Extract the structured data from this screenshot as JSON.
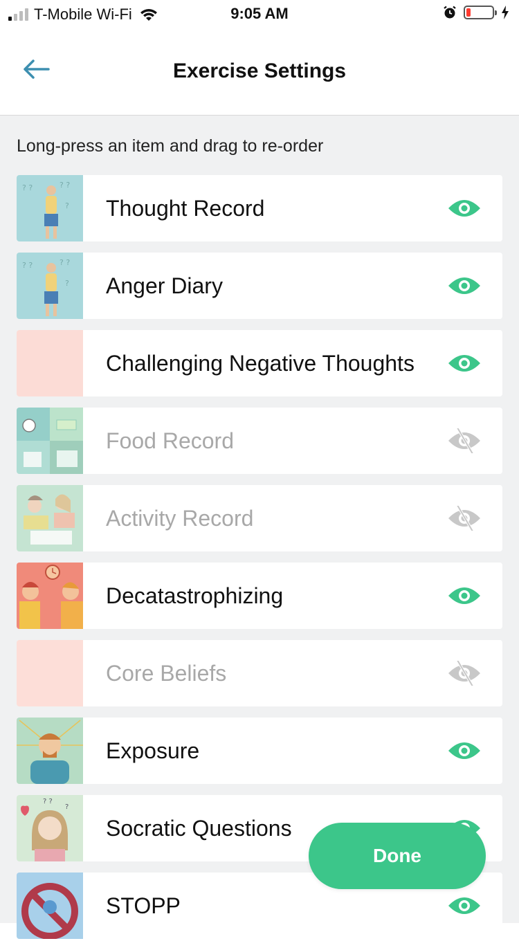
{
  "status_bar": {
    "carrier": "T-Mobile Wi-Fi",
    "time": "9:05 AM",
    "signal_bars": 4,
    "signal_active": 1
  },
  "header": {
    "title": "Exercise Settings",
    "back_icon": "arrow-left-icon"
  },
  "hint": "Long-press an item and drag to re-order",
  "colors": {
    "accent": "#3cc68a",
    "eye_visible": "#3cc68a",
    "eye_hidden": "#c8c8c8",
    "back_arrow": "#3d8fb0"
  },
  "exercises": [
    {
      "label": "Thought Record",
      "visible": true,
      "thumb": "confused-person"
    },
    {
      "label": "Anger Diary",
      "visible": true,
      "thumb": "confused-person"
    },
    {
      "label": "Challenging Negative Thoughts",
      "visible": true,
      "thumb": "blank-pink"
    },
    {
      "label": "Food Record",
      "visible": false,
      "thumb": "food-grid"
    },
    {
      "label": "Activity Record",
      "visible": false,
      "thumb": "people-desk"
    },
    {
      "label": "Decatastrophizing",
      "visible": true,
      "thumb": "arguing-people"
    },
    {
      "label": "Core Beliefs",
      "visible": false,
      "thumb": "blank-pink"
    },
    {
      "label": "Exposure",
      "visible": true,
      "thumb": "anxious-man"
    },
    {
      "label": "Socratic Questions",
      "visible": true,
      "thumb": "thinking-woman"
    },
    {
      "label": "STOPP",
      "visible": true,
      "thumb": "stop-sign"
    }
  ],
  "done_button": {
    "label": "Done"
  }
}
